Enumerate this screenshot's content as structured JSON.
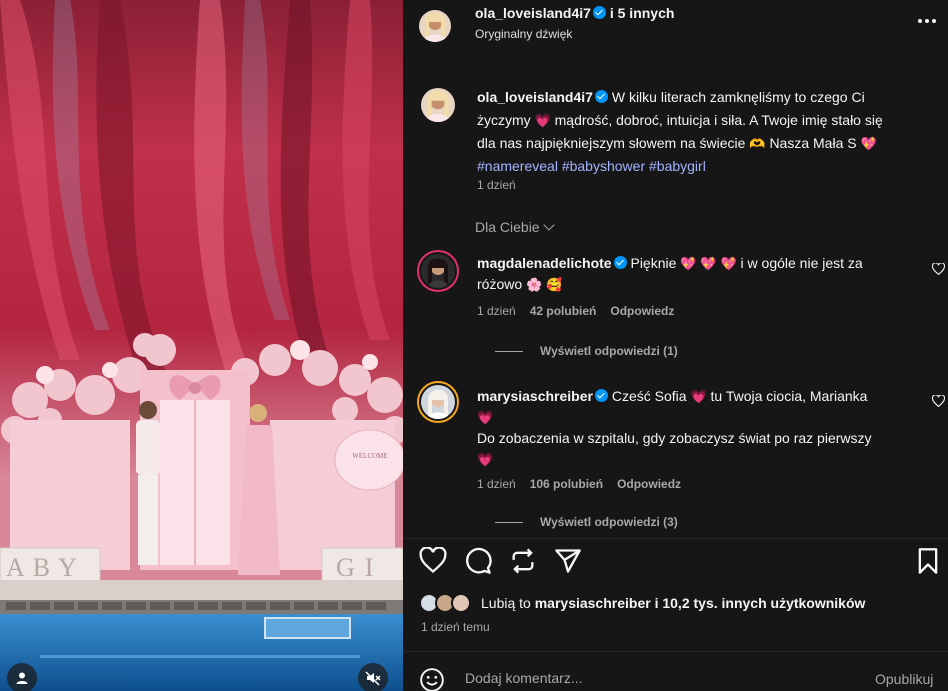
{
  "post": {
    "author": "ola_loveisland4i7",
    "coauthors": "i 5 innych",
    "audio": "Oryginalny dźwięk",
    "menu_icon": "more-horizontal-icon"
  },
  "media_overlay": {
    "baby_letters": "ABY",
    "girl_letters": "GI",
    "sign_text": "WELCOME"
  },
  "caption": {
    "author": "ola_loveisland4i7",
    "line1": "W kilku literach zamknęliśmy to czego Ci",
    "line2a": "życzymy",
    "line2b": "mądrość, dobroć, intuicja i siła. A Twoje imię stało się",
    "line3": "dla nas najpiękniejszym słowem na świecie",
    "line3b": "Nasza Mała S",
    "hashtags": "#namereveal #babyshower #babygirl",
    "time": "1 dzień"
  },
  "sort_label": "Dla Ciebie",
  "comments": [
    {
      "author": "magdalenadelichote",
      "text_a": "Pięknie",
      "text_b": "i w ogóle nie jest za",
      "text_c": "różowo",
      "time": "1 dzień",
      "likes": "42 polubień",
      "reply": "Odpowiedz",
      "view_replies": "Wyświetl odpowiedzi (1)"
    },
    {
      "author": "marysiaschreiber",
      "text_a": "Cześć Sofia",
      "text_b": "tu Twoja ciocia, Marianka",
      "text_c": "Do zobaczenia w szpitalu, gdy zobaczysz świat po raz pierwszy",
      "time": "1 dzień",
      "likes": "106 polubień",
      "reply": "Odpowiedz",
      "view_replies": "Wyświetl odpowiedzi (3)"
    }
  ],
  "likes_summary": {
    "prefix": "Lubią to",
    "user": "marysiaschreiber",
    "suffix": "i 10,2 tys. innych użytkowników"
  },
  "post_date": "1 dzień temu",
  "composer": {
    "placeholder": "Dodaj komentarz...",
    "publish": "Opublikuj"
  },
  "colors": {
    "panel_bg": "#161616",
    "accent": "#0095f6",
    "heart": "#ff3b6f",
    "hashtag": "#a3b4ff"
  }
}
